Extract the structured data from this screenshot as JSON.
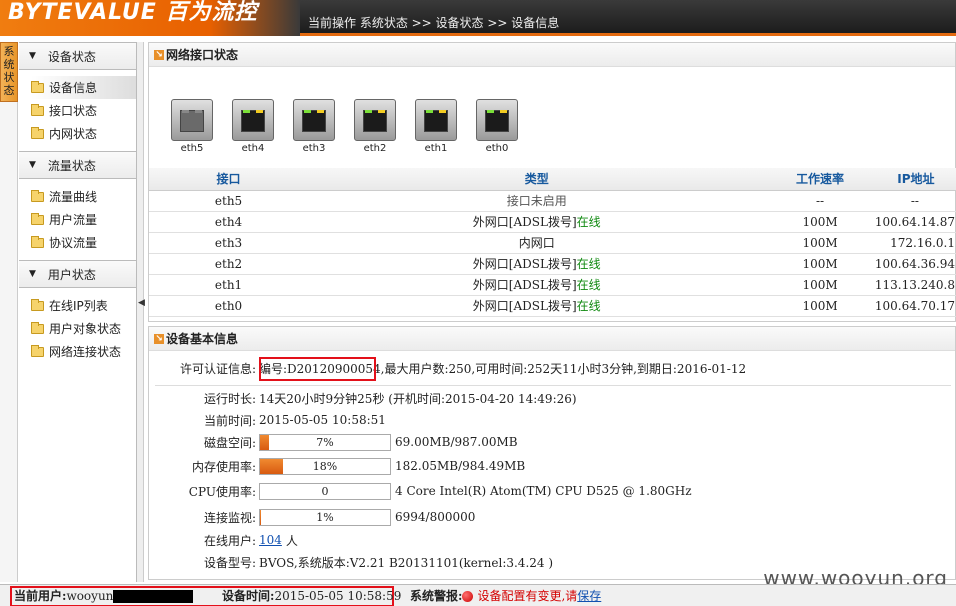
{
  "header": {
    "logo": "BYTEVALUE 百为流控",
    "breadcrumb": "当前操作 系统状态 >> 设备状态 >> 设备信息"
  },
  "vtab": "系统状态",
  "sidebar": {
    "groups": [
      {
        "title": "设备状态",
        "items": [
          "设备信息",
          "接口状态",
          "内网状态"
        ]
      },
      {
        "title": "流量状态",
        "items": [
          "流量曲线",
          "用户流量",
          "协议流量"
        ]
      },
      {
        "title": "用户状态",
        "items": [
          "在线IP列表",
          "用户对象状态",
          "网络连接状态"
        ]
      }
    ]
  },
  "network_panel": {
    "title": "网络接口状态",
    "ports": [
      "eth5",
      "eth4",
      "eth3",
      "eth2",
      "eth1",
      "eth0"
    ],
    "columns": [
      "接口",
      "类型",
      "工作速率",
      "IP地址"
    ],
    "rows": [
      {
        "iface": "eth5",
        "type": "接口未启用",
        "online": "",
        "speed": "--",
        "ip": "--"
      },
      {
        "iface": "eth4",
        "type": "外网口[ADSL拨号]",
        "online": "在线",
        "speed": "100M",
        "ip": "100.64.14.87"
      },
      {
        "iface": "eth3",
        "type": "内网口",
        "online": "",
        "speed": "100M",
        "ip": "172.16.0.1"
      },
      {
        "iface": "eth2",
        "type": "外网口[ADSL拨号]",
        "online": "在线",
        "speed": "100M",
        "ip": "100.64.36.94"
      },
      {
        "iface": "eth1",
        "type": "外网口[ADSL拨号]",
        "online": "在线",
        "speed": "100M",
        "ip": "113.13.240.8"
      },
      {
        "iface": "eth0",
        "type": "外网口[ADSL拨号]",
        "online": "在线",
        "speed": "100M",
        "ip": "100.64.70.17"
      }
    ]
  },
  "info_panel": {
    "title": "设备基本信息",
    "license_label": "许可认证信息:",
    "license_value": "编号:D20120900054,最大用户数:250,可用时间:252天11小时3分钟,到期日:2016-01-12",
    "uptime_label": "运行时长:",
    "uptime_value": "14天20小时9分钟25秒 (开机时间:2015-04-20 14:49:26)",
    "time_label": "当前时间:",
    "time_value": "2015-05-05 10:58:51",
    "disk_label": "磁盘空间:",
    "disk_pct": "7%",
    "disk_fraction": 0.07,
    "disk_detail": "69.00MB/987.00MB",
    "mem_label": "内存使用率:",
    "mem_pct": "18%",
    "mem_fraction": 0.18,
    "mem_detail": "182.05MB/984.49MB",
    "cpu_label": "CPU使用率:",
    "cpu_pct": "0",
    "cpu_fraction": 0,
    "cpu_detail": "4 Core Intel(R) Atom(TM) CPU D525 @ 1.80GHz",
    "conn_label": "连接监视:",
    "conn_pct": "1%",
    "conn_fraction": 0.01,
    "conn_detail": "6994/800000",
    "users_label": "在线用户:",
    "users_count": "104",
    "users_unit": "人",
    "model_label": "设备型号:",
    "model_value": "BVOS,系统版本:V2.21 B20131101(kernel:3.4.24 )"
  },
  "statusbar": {
    "user_label": "当前用户:",
    "user_value": "wooyun",
    "time_label": "设备时间:",
    "time_value": "2015-05-05 10:58:59",
    "alert_label": "系统警报:",
    "alert_text": "设备配置有变更,请",
    "alert_link": "保存"
  },
  "watermark": "www.wooyun.org"
}
